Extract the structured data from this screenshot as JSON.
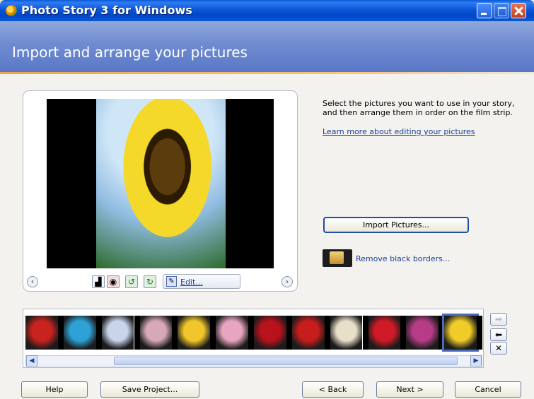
{
  "window": {
    "title": "Photo Story 3 for Windows",
    "header_title": "Import and arrange your pictures"
  },
  "preview": {
    "edit_label": "Edit..."
  },
  "info": {
    "instructions": "Select the pictures you want to use in your story, and then arrange them in order on the film strip.",
    "learn_more": "Learn more about editing your pictures",
    "import_label": "Import Pictures...",
    "remove_borders": "Remove black borders..."
  },
  "filmstrip": {
    "thumbnails": [
      {
        "name": "red-flower",
        "color": "#c8231f"
      },
      {
        "name": "red-spring-flowers",
        "color": "#2ea2d6"
      },
      {
        "name": "white-lily",
        "color": "#c7d4ea"
      },
      {
        "name": "pink-blossoms",
        "color": "#d7a9b8"
      },
      {
        "name": "yellow-flower",
        "color": "#f0c62a"
      },
      {
        "name": "pink-lily",
        "color": "#e7a5bf"
      },
      {
        "name": "red-rose",
        "color": "#b8121c"
      },
      {
        "name": "red-poinsettia",
        "color": "#c81d1d"
      },
      {
        "name": "white-blossoms",
        "color": "#e9dfc9"
      },
      {
        "name": "red-tulip",
        "color": "#cf1b27"
      },
      {
        "name": "purple-thistle",
        "color": "#b63c87"
      },
      {
        "name": "sunflower",
        "color": "#f1cc28"
      }
    ],
    "selected_index": 11
  },
  "buttons": {
    "help": "Help",
    "save_project": "Save Project...",
    "back": "< Back",
    "next": "Next >",
    "cancel": "Cancel"
  }
}
